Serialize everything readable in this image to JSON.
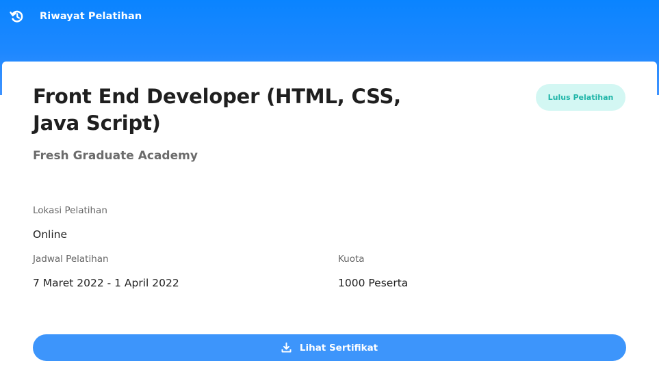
{
  "header": {
    "icon": "history-icon",
    "title": "Riwayat Pelatihan"
  },
  "course": {
    "title": "Front End Developer (HTML, CSS, Java Script)",
    "status": "Lulus Pelatihan",
    "organizer": "Fresh Graduate Academy",
    "location_label": "Lokasi Pelatihan",
    "location_value": "Online",
    "schedule_label": "Jadwal Pelatihan",
    "schedule_value": "7 Maret 2022 - 1 April 2022",
    "quota_label": "Kuota",
    "quota_value": "1000 Peserta"
  },
  "actions": {
    "certificate_label": "Lihat Sertifikat",
    "certificate_icon": "download-icon"
  },
  "colors": {
    "header_blue": "#0a84ff",
    "button_blue": "#3d95fb",
    "badge_bg": "#d3f7f3",
    "badge_text": "#1fb5a8"
  }
}
